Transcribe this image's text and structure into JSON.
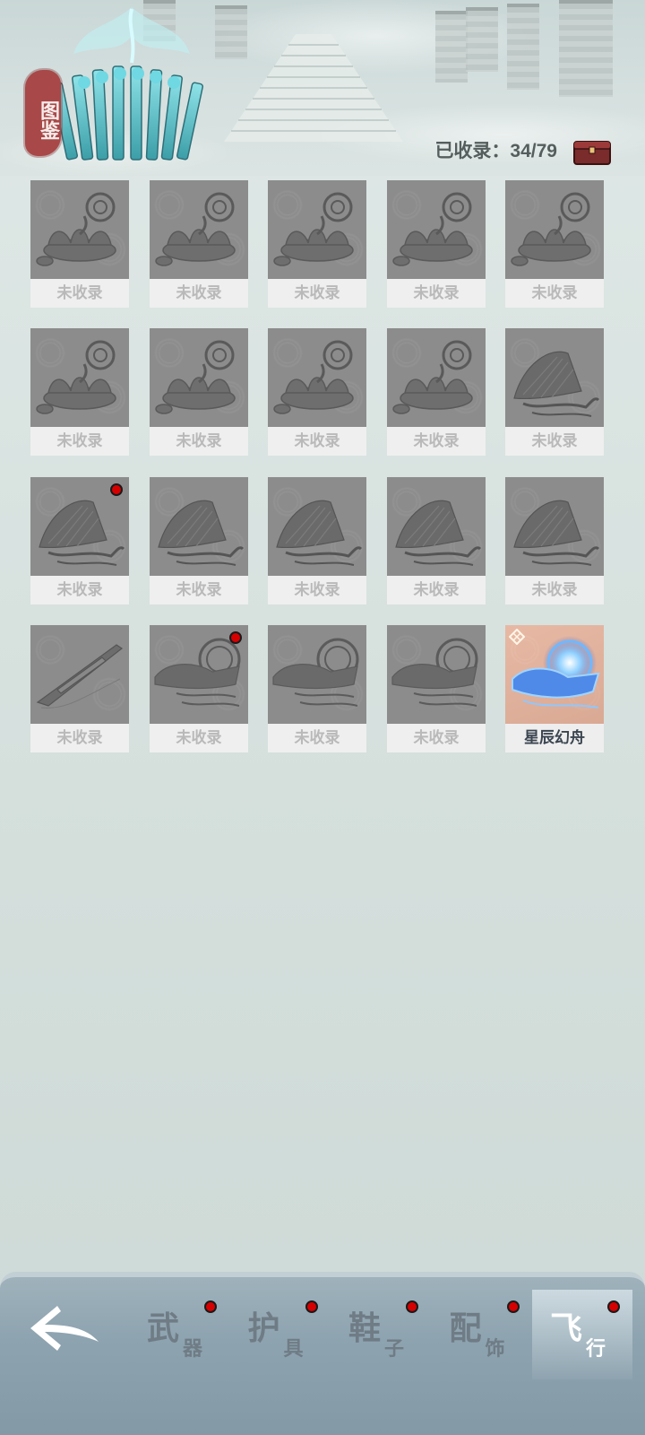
{
  "header": {
    "seal_text": "图鉴",
    "collected_text": "已收录：34/79"
  },
  "items": [
    {
      "label": "未收录",
      "art": "lotus",
      "owned": false,
      "new": false
    },
    {
      "label": "未收录",
      "art": "lotus",
      "owned": false,
      "new": false
    },
    {
      "label": "未收录",
      "art": "lotus",
      "owned": false,
      "new": false
    },
    {
      "label": "未收录",
      "art": "lotus",
      "owned": false,
      "new": false
    },
    {
      "label": "未收录",
      "art": "lotus",
      "owned": false,
      "new": false
    },
    {
      "label": "未收录",
      "art": "lotus",
      "owned": false,
      "new": false
    },
    {
      "label": "未收录",
      "art": "lotus",
      "owned": false,
      "new": false
    },
    {
      "label": "未收录",
      "art": "lotus",
      "owned": false,
      "new": false
    },
    {
      "label": "未收录",
      "art": "lotus",
      "owned": false,
      "new": false
    },
    {
      "label": "未收录",
      "art": "fan",
      "owned": false,
      "new": false
    },
    {
      "label": "未收录",
      "art": "fan",
      "owned": false,
      "new": true
    },
    {
      "label": "未收录",
      "art": "fan",
      "owned": false,
      "new": false
    },
    {
      "label": "未收录",
      "art": "fan",
      "owned": false,
      "new": false
    },
    {
      "label": "未收录",
      "art": "fan",
      "owned": false,
      "new": false
    },
    {
      "label": "未收录",
      "art": "fan",
      "owned": false,
      "new": false
    },
    {
      "label": "未收录",
      "art": "blade",
      "owned": false,
      "new": false
    },
    {
      "label": "未收录",
      "art": "boat",
      "owned": false,
      "new": true
    },
    {
      "label": "未收录",
      "art": "boat",
      "owned": false,
      "new": false
    },
    {
      "label": "未收录",
      "art": "boat",
      "owned": false,
      "new": false
    },
    {
      "label": "星辰幻舟",
      "art": "star-boat",
      "owned": true,
      "new": false
    }
  ],
  "tabs": [
    {
      "big": "武",
      "small": "器",
      "dot": true,
      "active": false
    },
    {
      "big": "护",
      "small": "具",
      "dot": true,
      "active": false
    },
    {
      "big": "鞋",
      "small": "子",
      "dot": true,
      "active": false
    },
    {
      "big": "配",
      "small": "饰",
      "dot": true,
      "active": false
    },
    {
      "big": "飞",
      "small": "行",
      "dot": true,
      "active": true
    }
  ],
  "colors": {
    "locked_tile": "#8c8c8c",
    "owned_tile": "#e3b29d",
    "red_dot": "#d60000",
    "seal": "#a84848"
  }
}
